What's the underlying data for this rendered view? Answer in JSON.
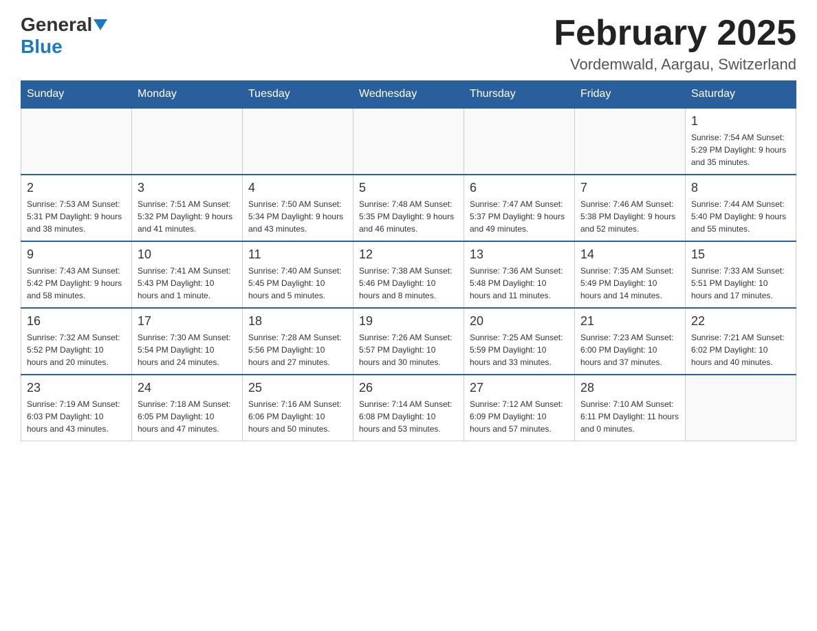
{
  "logo": {
    "general": "General",
    "blue": "Blue"
  },
  "header": {
    "month_title": "February 2025",
    "location": "Vordemwald, Aargau, Switzerland"
  },
  "weekdays": [
    "Sunday",
    "Monday",
    "Tuesday",
    "Wednesday",
    "Thursday",
    "Friday",
    "Saturday"
  ],
  "weeks": [
    [
      {
        "day": "",
        "info": ""
      },
      {
        "day": "",
        "info": ""
      },
      {
        "day": "",
        "info": ""
      },
      {
        "day": "",
        "info": ""
      },
      {
        "day": "",
        "info": ""
      },
      {
        "day": "",
        "info": ""
      },
      {
        "day": "1",
        "info": "Sunrise: 7:54 AM\nSunset: 5:29 PM\nDaylight: 9 hours and 35 minutes."
      }
    ],
    [
      {
        "day": "2",
        "info": "Sunrise: 7:53 AM\nSunset: 5:31 PM\nDaylight: 9 hours and 38 minutes."
      },
      {
        "day": "3",
        "info": "Sunrise: 7:51 AM\nSunset: 5:32 PM\nDaylight: 9 hours and 41 minutes."
      },
      {
        "day": "4",
        "info": "Sunrise: 7:50 AM\nSunset: 5:34 PM\nDaylight: 9 hours and 43 minutes."
      },
      {
        "day": "5",
        "info": "Sunrise: 7:48 AM\nSunset: 5:35 PM\nDaylight: 9 hours and 46 minutes."
      },
      {
        "day": "6",
        "info": "Sunrise: 7:47 AM\nSunset: 5:37 PM\nDaylight: 9 hours and 49 minutes."
      },
      {
        "day": "7",
        "info": "Sunrise: 7:46 AM\nSunset: 5:38 PM\nDaylight: 9 hours and 52 minutes."
      },
      {
        "day": "8",
        "info": "Sunrise: 7:44 AM\nSunset: 5:40 PM\nDaylight: 9 hours and 55 minutes."
      }
    ],
    [
      {
        "day": "9",
        "info": "Sunrise: 7:43 AM\nSunset: 5:42 PM\nDaylight: 9 hours and 58 minutes."
      },
      {
        "day": "10",
        "info": "Sunrise: 7:41 AM\nSunset: 5:43 PM\nDaylight: 10 hours and 1 minute."
      },
      {
        "day": "11",
        "info": "Sunrise: 7:40 AM\nSunset: 5:45 PM\nDaylight: 10 hours and 5 minutes."
      },
      {
        "day": "12",
        "info": "Sunrise: 7:38 AM\nSunset: 5:46 PM\nDaylight: 10 hours and 8 minutes."
      },
      {
        "day": "13",
        "info": "Sunrise: 7:36 AM\nSunset: 5:48 PM\nDaylight: 10 hours and 11 minutes."
      },
      {
        "day": "14",
        "info": "Sunrise: 7:35 AM\nSunset: 5:49 PM\nDaylight: 10 hours and 14 minutes."
      },
      {
        "day": "15",
        "info": "Sunrise: 7:33 AM\nSunset: 5:51 PM\nDaylight: 10 hours and 17 minutes."
      }
    ],
    [
      {
        "day": "16",
        "info": "Sunrise: 7:32 AM\nSunset: 5:52 PM\nDaylight: 10 hours and 20 minutes."
      },
      {
        "day": "17",
        "info": "Sunrise: 7:30 AM\nSunset: 5:54 PM\nDaylight: 10 hours and 24 minutes."
      },
      {
        "day": "18",
        "info": "Sunrise: 7:28 AM\nSunset: 5:56 PM\nDaylight: 10 hours and 27 minutes."
      },
      {
        "day": "19",
        "info": "Sunrise: 7:26 AM\nSunset: 5:57 PM\nDaylight: 10 hours and 30 minutes."
      },
      {
        "day": "20",
        "info": "Sunrise: 7:25 AM\nSunset: 5:59 PM\nDaylight: 10 hours and 33 minutes."
      },
      {
        "day": "21",
        "info": "Sunrise: 7:23 AM\nSunset: 6:00 PM\nDaylight: 10 hours and 37 minutes."
      },
      {
        "day": "22",
        "info": "Sunrise: 7:21 AM\nSunset: 6:02 PM\nDaylight: 10 hours and 40 minutes."
      }
    ],
    [
      {
        "day": "23",
        "info": "Sunrise: 7:19 AM\nSunset: 6:03 PM\nDaylight: 10 hours and 43 minutes."
      },
      {
        "day": "24",
        "info": "Sunrise: 7:18 AM\nSunset: 6:05 PM\nDaylight: 10 hours and 47 minutes."
      },
      {
        "day": "25",
        "info": "Sunrise: 7:16 AM\nSunset: 6:06 PM\nDaylight: 10 hours and 50 minutes."
      },
      {
        "day": "26",
        "info": "Sunrise: 7:14 AM\nSunset: 6:08 PM\nDaylight: 10 hours and 53 minutes."
      },
      {
        "day": "27",
        "info": "Sunrise: 7:12 AM\nSunset: 6:09 PM\nDaylight: 10 hours and 57 minutes."
      },
      {
        "day": "28",
        "info": "Sunrise: 7:10 AM\nSunset: 6:11 PM\nDaylight: 11 hours and 0 minutes."
      },
      {
        "day": "",
        "info": ""
      }
    ]
  ]
}
